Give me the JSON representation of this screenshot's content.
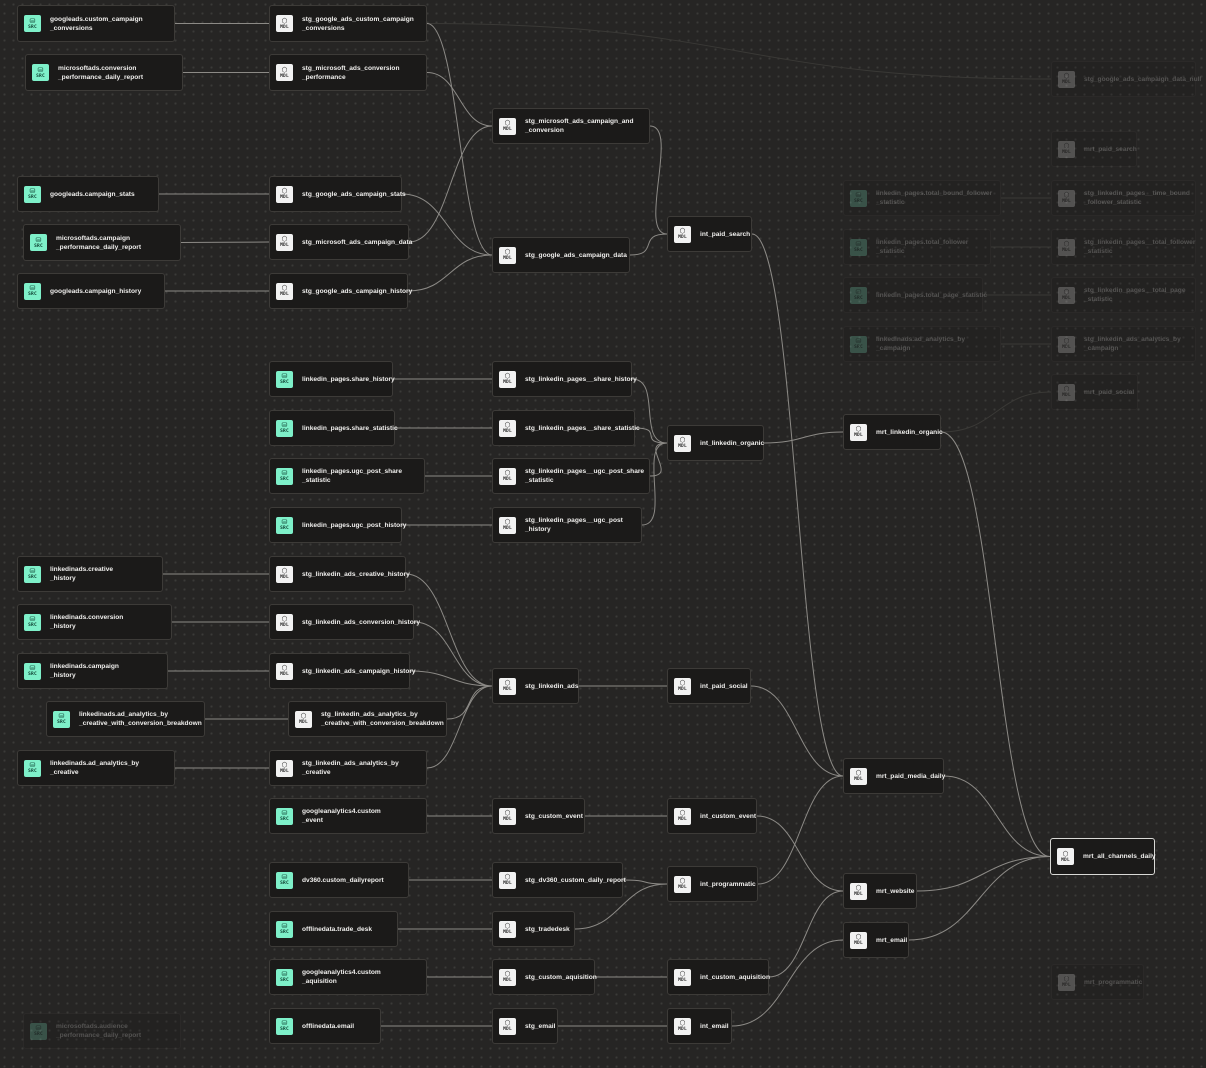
{
  "nodes": [
    {
      "id": "n1",
      "type": "SRC",
      "label": "googleads.custom_campaign\n_conversions"
    },
    {
      "id": "n2",
      "type": "MDL",
      "label": "stg_google_ads_custom_campaign\n_conversions"
    },
    {
      "id": "n3",
      "type": "SRC",
      "label": "microsoftads.conversion\n_performance_daily_report"
    },
    {
      "id": "n4",
      "type": "MDL",
      "label": "stg_microsoft_ads_conversion\n_performance"
    },
    {
      "id": "n5",
      "type": "MDL",
      "label": "stg_microsoft_ads_campaign_and\n_conversion"
    },
    {
      "id": "n6",
      "type": "SRC",
      "label": "googleads.campaign_stats"
    },
    {
      "id": "n7",
      "type": "MDL",
      "label": "stg_google_ads_campaign_stats"
    },
    {
      "id": "n8",
      "type": "SRC",
      "label": "microsoftads.campaign\n_performance_daily_report"
    },
    {
      "id": "n9",
      "type": "MDL",
      "label": "stg_microsoft_ads_campaign_data"
    },
    {
      "id": "n10",
      "type": "MDL",
      "label": "stg_google_ads_campaign_data"
    },
    {
      "id": "n11",
      "type": "SRC",
      "label": "googleads.campaign_history"
    },
    {
      "id": "n12",
      "type": "MDL",
      "label": "stg_google_ads_campaign_history"
    },
    {
      "id": "n13",
      "type": "MDL",
      "label": "int_paid_search"
    },
    {
      "id": "n14",
      "type": "SRC",
      "label": "linkedin_pages.share_history"
    },
    {
      "id": "n15",
      "type": "MDL",
      "label": "stg_linkedin_pages__share_history"
    },
    {
      "id": "n16",
      "type": "SRC",
      "label": "linkedin_pages.share_statistic"
    },
    {
      "id": "n17",
      "type": "MDL",
      "label": "stg_linkedin_pages__share_statistic"
    },
    {
      "id": "n18",
      "type": "MDL",
      "label": "int_linkedin_organic"
    },
    {
      "id": "n19",
      "type": "SRC",
      "label": "linkedin_pages.ugc_post_share\n_statistic"
    },
    {
      "id": "n20",
      "type": "MDL",
      "label": "stg_linkedin_pages__ugc_post_share\n_statistic"
    },
    {
      "id": "n21",
      "type": "SRC",
      "label": "linkedin_pages.ugc_post_history"
    },
    {
      "id": "n22",
      "type": "MDL",
      "label": "stg_linkedin_pages__ugc_post\n_history"
    },
    {
      "id": "n23",
      "type": "MDL",
      "label": "mrt_linkedin_organic"
    },
    {
      "id": "n24",
      "type": "SRC",
      "label": "linkedinads.creative\n_history"
    },
    {
      "id": "n25",
      "type": "MDL",
      "label": "stg_linkedin_ads_creative_history"
    },
    {
      "id": "n26",
      "type": "SRC",
      "label": "linkedinads.conversion\n_history"
    },
    {
      "id": "n27",
      "type": "MDL",
      "label": "stg_linkedin_ads_conversion_history"
    },
    {
      "id": "n28",
      "type": "SRC",
      "label": "linkedinads.campaign\n_history"
    },
    {
      "id": "n29",
      "type": "MDL",
      "label": "stg_linkedin_ads_campaign_history"
    },
    {
      "id": "n30",
      "type": "MDL",
      "label": "stg_linkedin_ads"
    },
    {
      "id": "n31",
      "type": "MDL",
      "label": "int_paid_social"
    },
    {
      "id": "n32",
      "type": "SRC",
      "label": "linkedinads.ad_analytics_by\n_creative_with_conversion_breakdown"
    },
    {
      "id": "n33",
      "type": "MDL",
      "label": "stg_linkedin_ads_analytics_by\n_creative_with_conversion_breakdown"
    },
    {
      "id": "n34",
      "type": "SRC",
      "label": "linkedinads.ad_analytics_by\n_creative"
    },
    {
      "id": "n35",
      "type": "MDL",
      "label": "stg_linkedin_ads_analytics_by\n_creative"
    },
    {
      "id": "n36",
      "type": "MDL",
      "label": "mrt_paid_media_daily"
    },
    {
      "id": "n37",
      "type": "SRC",
      "label": "googleanalytics4.custom\n_event"
    },
    {
      "id": "n38",
      "type": "MDL",
      "label": "stg_custom_event"
    },
    {
      "id": "n39",
      "type": "MDL",
      "label": "int_custom_event"
    },
    {
      "id": "n40",
      "type": "MDL",
      "label": "mrt_all_channels_daily"
    },
    {
      "id": "n41",
      "type": "SRC",
      "label": "dv360.custom_dailyreport"
    },
    {
      "id": "n42",
      "type": "MDL",
      "label": "stg_dv360_custom_daily_report"
    },
    {
      "id": "n43",
      "type": "MDL",
      "label": "int_programmatic"
    },
    {
      "id": "n44",
      "type": "MDL",
      "label": "mrt_website"
    },
    {
      "id": "n45",
      "type": "SRC",
      "label": "offlinedata.trade_desk"
    },
    {
      "id": "n46",
      "type": "MDL",
      "label": "stg_tradedesk"
    },
    {
      "id": "n47",
      "type": "MDL",
      "label": "mrt_email"
    },
    {
      "id": "n48",
      "type": "SRC",
      "label": "googleanalytics4.custom\n_aquisition"
    },
    {
      "id": "n49",
      "type": "MDL",
      "label": "stg_custom_aquisition"
    },
    {
      "id": "n50",
      "type": "MDL",
      "label": "int_custom_aquisition"
    },
    {
      "id": "n51",
      "type": "SRC",
      "label": "offlinedata.email"
    },
    {
      "id": "n52",
      "type": "MDL",
      "label": "stg_email"
    },
    {
      "id": "n53",
      "type": "MDL",
      "label": "int_email"
    },
    {
      "id": "d1",
      "type": "MDL",
      "label": "stg_google_ads_campaign_data_null",
      "dim": true
    },
    {
      "id": "d2",
      "type": "MDL",
      "label": "mrt_paid_search",
      "dim": true
    },
    {
      "id": "d3",
      "type": "SRC",
      "label": "linkedin_pages.total_bound_follower\n_statistic",
      "dim": true
    },
    {
      "id": "d4",
      "type": "MDL",
      "label": "stg_linkedin_pages__time_bound\n_follower_statistic",
      "dim": true
    },
    {
      "id": "d5",
      "type": "SRC",
      "label": "linkedin_pages.total_follower\n_statistic",
      "dim": true
    },
    {
      "id": "d6",
      "type": "MDL",
      "label": "stg_linkedin_pages__total_follower\n_statistic",
      "dim": true
    },
    {
      "id": "d7",
      "type": "SRC",
      "label": "linkedin_pages.total_page_statistic",
      "dim": true
    },
    {
      "id": "d8",
      "type": "MDL",
      "label": "stg_linkedin_pages__total_page\n_statistic",
      "dim": true
    },
    {
      "id": "d9",
      "type": "SRC",
      "label": "linkedinads.ad_analytics_by\n_campaign",
      "dim": true
    },
    {
      "id": "d10",
      "type": "MDL",
      "label": "stg_linkedin_ads_analytics_by\n_campaign",
      "dim": true
    },
    {
      "id": "d11",
      "type": "MDL",
      "label": "mrt_paid_social",
      "dim": true
    },
    {
      "id": "d12",
      "type": "MDL",
      "label": "mrt_programmatic",
      "dim": true
    },
    {
      "id": "d13",
      "type": "SRC",
      "label": "microsoftads.audience\n_performance_daily_report",
      "dim": true
    }
  ],
  "edges": [
    [
      "n1",
      "n2"
    ],
    [
      "n3",
      "n4"
    ],
    [
      "n6",
      "n7"
    ],
    [
      "n8",
      "n9"
    ],
    [
      "n11",
      "n12"
    ],
    [
      "n2",
      "n10"
    ],
    [
      "n4",
      "n5"
    ],
    [
      "n7",
      "n10"
    ],
    [
      "n9",
      "n5"
    ],
    [
      "n12",
      "n10"
    ],
    [
      "n5",
      "n13"
    ],
    [
      "n10",
      "n13"
    ],
    [
      "n14",
      "n15"
    ],
    [
      "n16",
      "n17"
    ],
    [
      "n19",
      "n20"
    ],
    [
      "n21",
      "n22"
    ],
    [
      "n15",
      "n18"
    ],
    [
      "n17",
      "n18"
    ],
    [
      "n20",
      "n18"
    ],
    [
      "n22",
      "n18"
    ],
    [
      "n18",
      "n23"
    ],
    [
      "n24",
      "n25"
    ],
    [
      "n26",
      "n27"
    ],
    [
      "n28",
      "n29"
    ],
    [
      "n32",
      "n33"
    ],
    [
      "n34",
      "n35"
    ],
    [
      "n25",
      "n30"
    ],
    [
      "n27",
      "n30"
    ],
    [
      "n29",
      "n30"
    ],
    [
      "n33",
      "n30"
    ],
    [
      "n35",
      "n30"
    ],
    [
      "n30",
      "n31"
    ],
    [
      "n13",
      "n36"
    ],
    [
      "n31",
      "n36"
    ],
    [
      "n43",
      "n36"
    ],
    [
      "n37",
      "n38"
    ],
    [
      "n38",
      "n39"
    ],
    [
      "n39",
      "n44"
    ],
    [
      "n41",
      "n42"
    ],
    [
      "n42",
      "n43"
    ],
    [
      "n45",
      "n46"
    ],
    [
      "n46",
      "n43"
    ],
    [
      "n48",
      "n49"
    ],
    [
      "n49",
      "n50"
    ],
    [
      "n50",
      "n44"
    ],
    [
      "n51",
      "n52"
    ],
    [
      "n52",
      "n53"
    ],
    [
      "n53",
      "n47"
    ],
    [
      "n23",
      "n40"
    ],
    [
      "n36",
      "n40"
    ],
    [
      "n44",
      "n40"
    ],
    [
      "n47",
      "n40"
    ]
  ],
  "dim_edges": [
    [
      "n2",
      "d1"
    ],
    [
      "d3",
      "d4"
    ],
    [
      "d5",
      "d6"
    ],
    [
      "d7",
      "d8"
    ],
    [
      "d9",
      "d10"
    ],
    [
      "n23",
      "d11"
    ]
  ]
}
